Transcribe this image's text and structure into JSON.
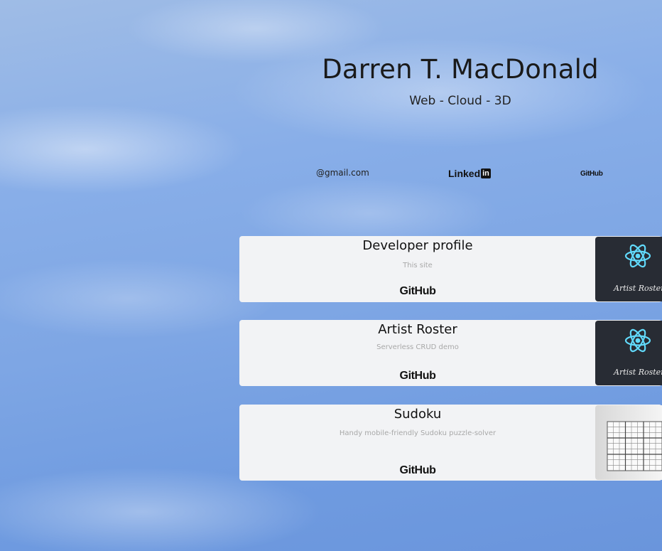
{
  "header": {
    "name": "Darren T. MacDonald",
    "tagline": "Web - Cloud - 3D"
  },
  "contacts": {
    "email": "@gmail.com",
    "linkedin_word": "Linked",
    "linkedin_box": "in",
    "github": "GitHub"
  },
  "colors": {
    "card_bg": "#f2f3f5",
    "react_thumb_bg": "#282c34",
    "react_logo": "#61dafb"
  },
  "projects": [
    {
      "title": "Developer profile",
      "description": "This site",
      "link_label": "GitHub",
      "thumbnail": "react-logo-icon",
      "thumbnail_caption": "Artist Roster"
    },
    {
      "title": "Artist Roster",
      "description": "Serverless CRUD demo",
      "link_label": "GitHub",
      "thumbnail": "react-logo-icon",
      "thumbnail_caption": "Artist Roster"
    },
    {
      "title": "Sudoku",
      "description": "Handy mobile-friendly Sudoku puzzle-solver",
      "link_label": "GitHub",
      "thumbnail": "sudoku-grid-icon"
    }
  ]
}
